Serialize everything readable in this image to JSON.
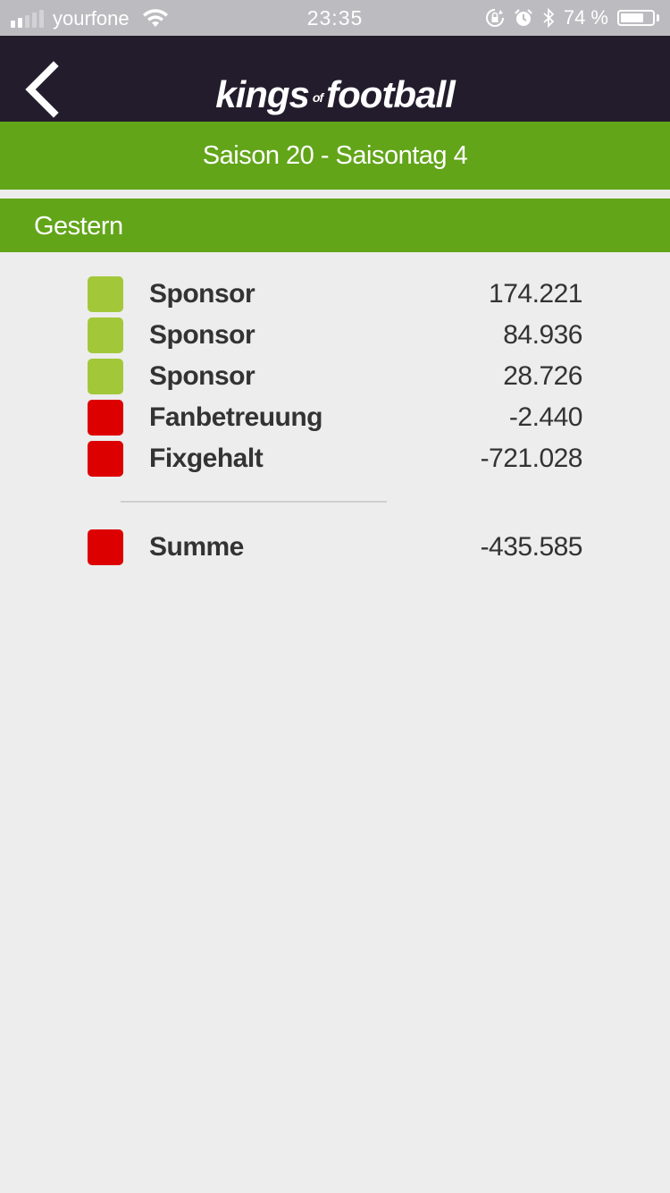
{
  "status_bar": {
    "carrier": "yourfone",
    "time": "23:35",
    "battery": "74 %",
    "battery_level": 0.74
  },
  "navbar": {
    "logo_left": "kings",
    "logo_mid": "of",
    "logo_right": "football"
  },
  "season_title": "Saison 20 - Saisontag 4",
  "section_title": "Gestern",
  "colors": {
    "positive": "#a2c83a",
    "negative": "#dd0000",
    "accent_green": "#62a519",
    "navbar": "#231c2c"
  },
  "entries": [
    {
      "label": "Sponsor",
      "value": "174.221",
      "type": "positive"
    },
    {
      "label": "Sponsor",
      "value": "84.936",
      "type": "positive"
    },
    {
      "label": "Sponsor",
      "value": "28.726",
      "type": "positive"
    },
    {
      "label": "Fanbetreuung",
      "value": "-2.440",
      "type": "negative"
    },
    {
      "label": "Fixgehalt",
      "value": "-721.028",
      "type": "negative"
    }
  ],
  "total": {
    "label": "Summe",
    "value": "-435.585",
    "type": "negative"
  }
}
